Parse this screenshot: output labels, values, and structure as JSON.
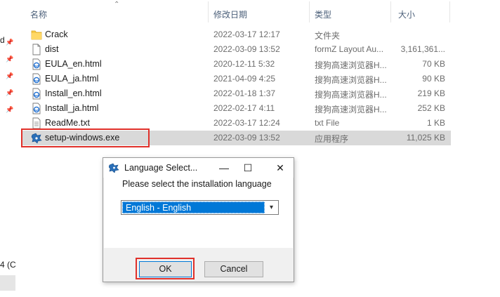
{
  "nav": {
    "cut_text_top": "d",
    "cut_text_bottom": "4 (C"
  },
  "header": {
    "name": "名称",
    "date": "修改日期",
    "type": "类型",
    "size": "大小"
  },
  "files": [
    {
      "icon": "folder-icon",
      "name": "Crack",
      "date": "2022-03-17 12:17",
      "type": "文件夹",
      "size": ""
    },
    {
      "icon": "file-icon",
      "name": "dist",
      "date": "2022-03-09 13:52",
      "type": "formZ Layout Au...",
      "size": "3,161,361..."
    },
    {
      "icon": "html-file-icon",
      "name": "EULA_en.html",
      "date": "2020-12-11 5:32",
      "type": "搜狗高速浏览器H...",
      "size": "70 KB"
    },
    {
      "icon": "html-file-icon",
      "name": "EULA_ja.html",
      "date": "2021-04-09 4:25",
      "type": "搜狗高速浏览器H...",
      "size": "90 KB"
    },
    {
      "icon": "html-file-icon",
      "name": "Install_en.html",
      "date": "2022-01-18 1:37",
      "type": "搜狗高速浏览器H...",
      "size": "219 KB"
    },
    {
      "icon": "html-file-icon",
      "name": "Install_ja.html",
      "date": "2022-02-17 4:11",
      "type": "搜狗高速浏览器H...",
      "size": "252 KB"
    },
    {
      "icon": "text-file-icon",
      "name": "ReadMe.txt",
      "date": "2022-03-17 12:24",
      "type": "txt File",
      "size": "1 KB"
    },
    {
      "icon": "installer-icon",
      "name": "setup-windows.exe",
      "date": "2022-03-09 13:52",
      "type": "应用程序",
      "size": "11,025 KB"
    }
  ],
  "dialog": {
    "title": "Language Select...",
    "minimize": "—",
    "maximize": "☐",
    "close": "✕",
    "prompt": "Please select the installation language",
    "selected_language": "English - English",
    "ok_label": "OK",
    "cancel_label": "Cancel"
  },
  "colors": {
    "highlight": "#e0302a",
    "selection": "#0078d7",
    "selected_row": "#d9d9d9"
  }
}
